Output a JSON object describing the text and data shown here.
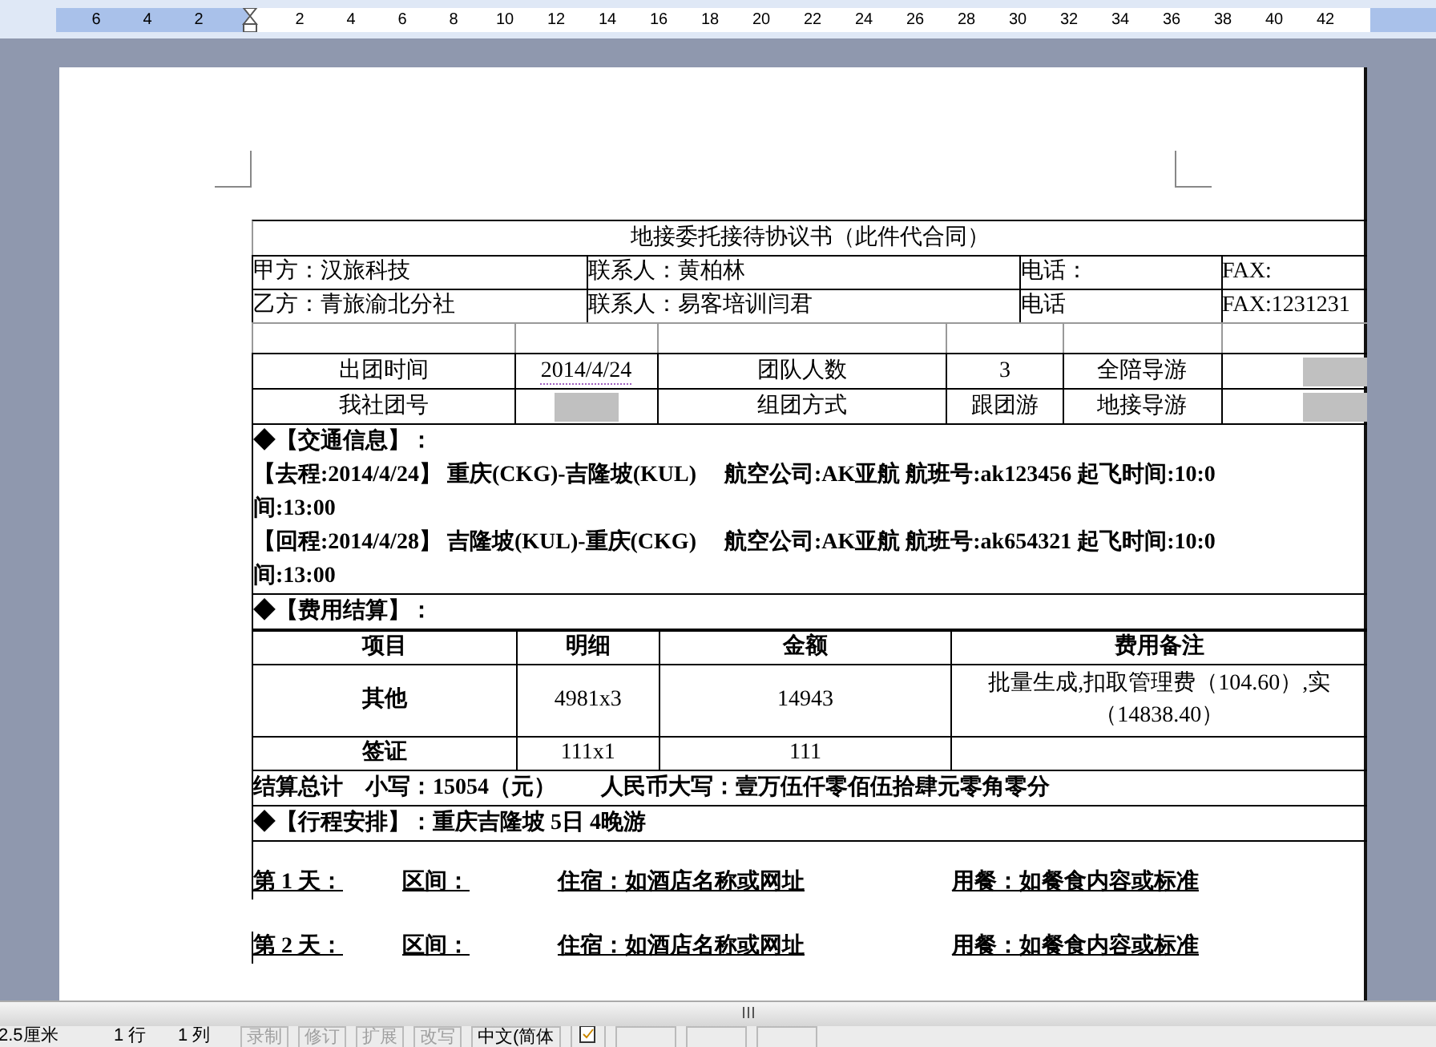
{
  "ruler": {
    "labels": [
      "6",
      "4",
      "2",
      "2",
      "4",
      "6",
      "8",
      "10",
      "12",
      "14",
      "16",
      "18",
      "20",
      "22",
      "24",
      "26",
      "28",
      "30",
      "32",
      "34",
      "36",
      "38",
      "40",
      "42"
    ]
  },
  "document": {
    "title": "地接委托接待协议书（此件代合同）",
    "parties": [
      {
        "cells": [
          "甲方：汉旅科技",
          "联系人：黄柏林",
          "电话：",
          "FAX:"
        ]
      },
      {
        "cells": [
          "乙方：青旅渝北分社",
          "联系人：易客培训闫君",
          "电话",
          "FAX:1231231"
        ]
      }
    ],
    "group_info": [
      {
        "cells": [
          {
            "kind": "text",
            "text": "出团时间"
          },
          {
            "kind": "date",
            "text": "2014/4/24"
          },
          {
            "kind": "text",
            "text": "团队人数"
          },
          {
            "kind": "text",
            "text": "3"
          },
          {
            "kind": "text",
            "text": "全陪导游"
          },
          {
            "kind": "redacted"
          }
        ]
      },
      {
        "cells": [
          {
            "kind": "text",
            "text": "我社团号"
          },
          {
            "kind": "redacted"
          },
          {
            "kind": "text",
            "text": "组团方式"
          },
          {
            "kind": "text",
            "text": "跟团游"
          },
          {
            "kind": "text",
            "text": "地接导游"
          },
          {
            "kind": "redacted"
          }
        ]
      }
    ],
    "transport": {
      "heading": "◆【交通信息】：",
      "legs": [
        {
          "lines": [
            "【去程:2014/4/24】 重庆(CKG)-吉隆坡(KUL)　 航空公司:AK亚航  航班号:ak123456  起飞时间:10:0",
            "间:13:00"
          ]
        },
        {
          "lines": [
            "【回程:2014/4/28】 吉隆坡(KUL)-重庆(CKG)　 航空公司:AK亚航  航班号:ak654321  起飞时间:10:0",
            "间:13:00"
          ]
        }
      ]
    },
    "fees": {
      "heading": "◆【费用结算】：",
      "columns": [
        "项目",
        "明细",
        "金额",
        "费用备注"
      ],
      "rows": [
        {
          "cells": [
            [
              "其他"
            ],
            [
              "4981x3"
            ],
            [
              "14943"
            ],
            [
              "批量生成,扣取管理费（104.60）,实",
              "（14838.40）"
            ]
          ]
        },
        {
          "cells": [
            [
              "签证"
            ],
            [
              "111x1"
            ],
            [
              "111"
            ],
            []
          ]
        }
      ],
      "total": "结算总计　小写：15054（元）　　人民币大写：壹万伍仟零佰伍拾肆元零角零分"
    },
    "itinerary": {
      "heading": "◆【行程安排】：重庆吉隆坡 5日 4晚游",
      "days": [
        {
          "day": "第 1 天：",
          "segment": "区间：",
          "lodging": "住宿：如酒店名称或网址",
          "meals": "用餐：如餐食内容或标准"
        },
        {
          "day": "第 2 天：",
          "segment": "区间：",
          "lodging": "住宿：如酒店名称或网址",
          "meals": "用餐：如餐食内容或标准"
        }
      ]
    }
  },
  "status_bar": {
    "items": [
      {
        "text": "2.5厘米",
        "disabled": false,
        "boxed": false
      },
      {
        "text": "1 行",
        "disabled": false,
        "boxed": false
      },
      {
        "text": "1 列",
        "disabled": false,
        "boxed": false
      },
      {
        "text": "录制",
        "disabled": true,
        "boxed": true
      },
      {
        "text": "修订",
        "disabled": true,
        "boxed": true
      },
      {
        "text": "扩展",
        "disabled": true,
        "boxed": true
      },
      {
        "text": "改写",
        "disabled": true,
        "boxed": true
      },
      {
        "text": "中文(简体",
        "disabled": false,
        "boxed": true
      }
    ]
  }
}
